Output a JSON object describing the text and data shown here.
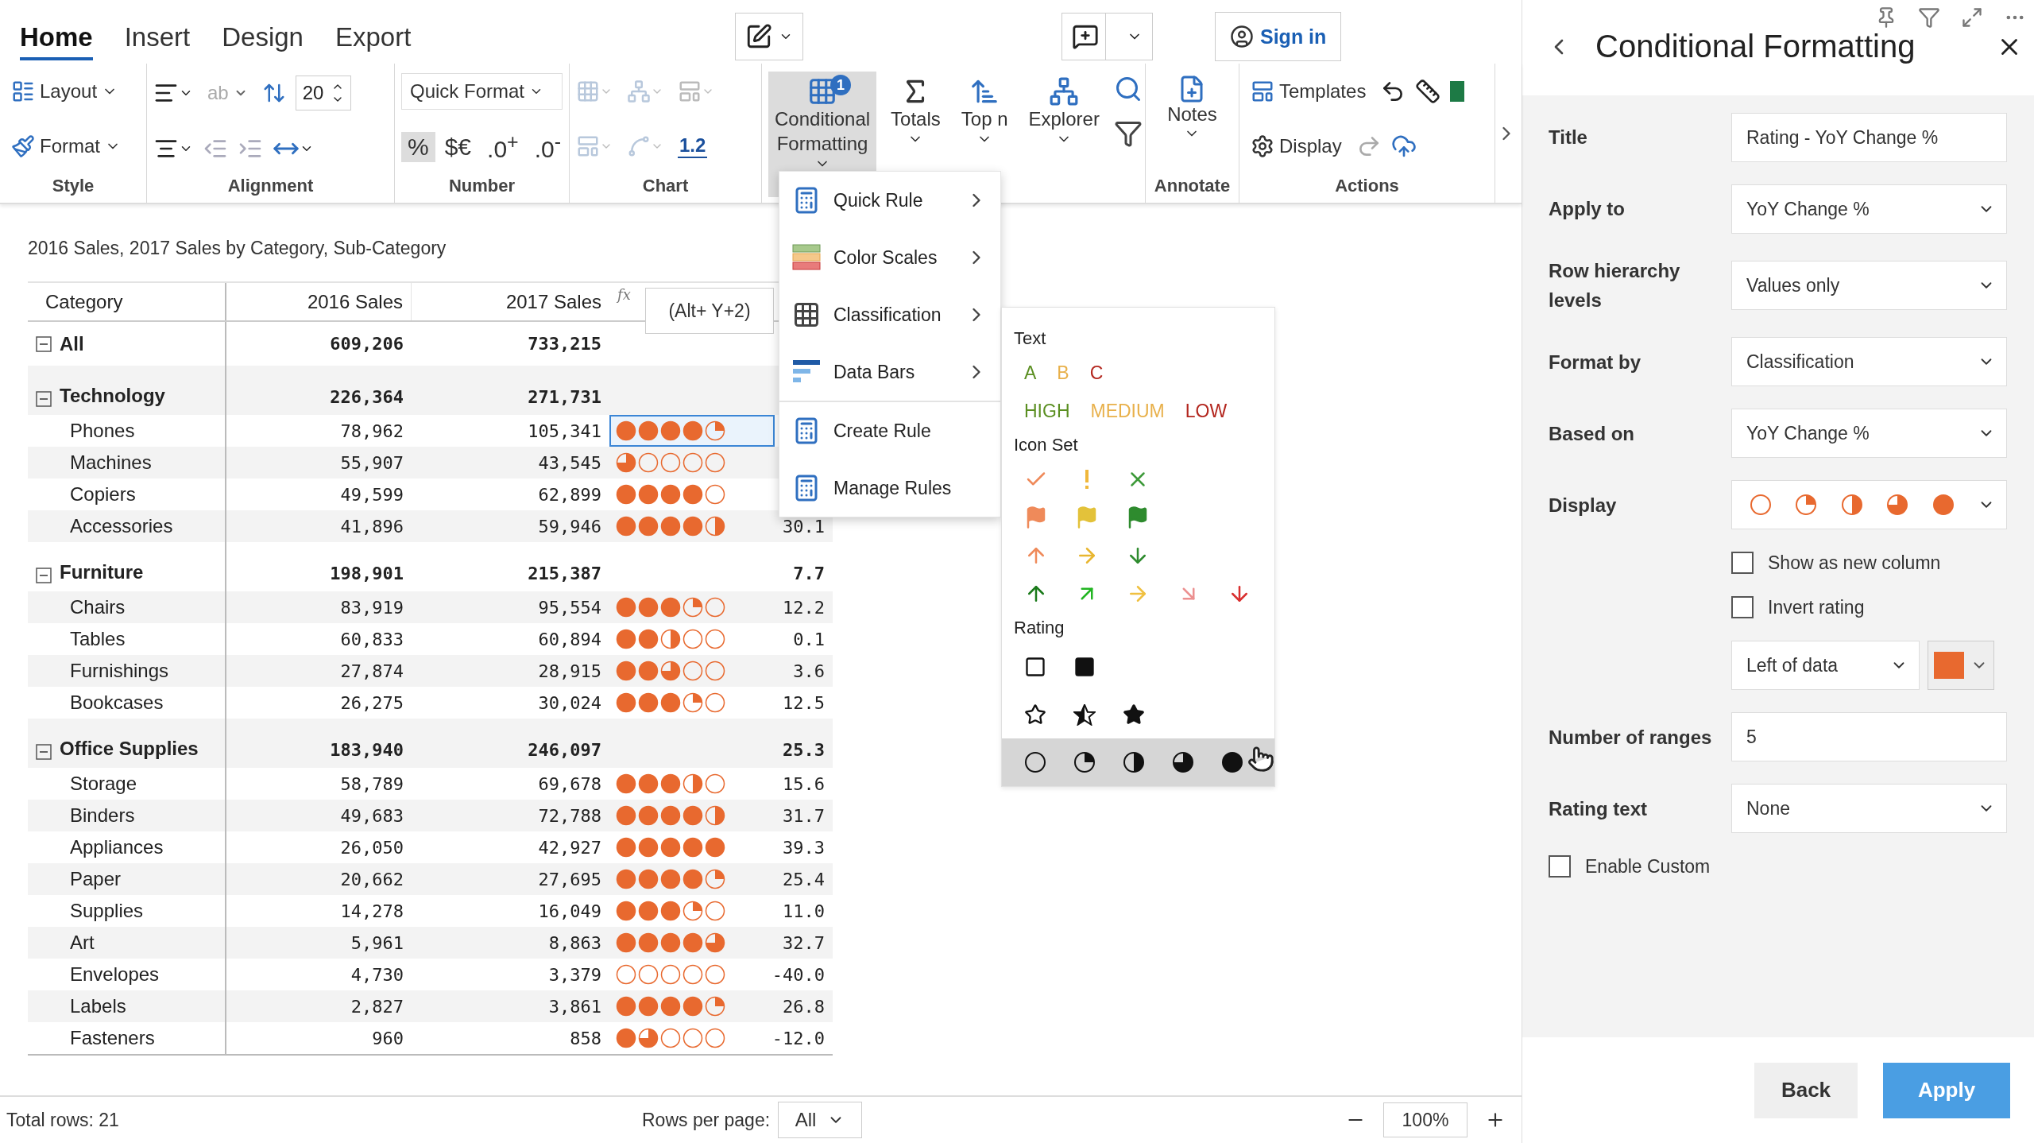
{
  "ribbon": {
    "tabs": [
      {
        "label": "Home",
        "selected": true
      },
      {
        "label": "Insert",
        "selected": false
      },
      {
        "label": "Design",
        "selected": false
      },
      {
        "label": "Export",
        "selected": false
      }
    ],
    "sign_in": "Sign in",
    "groups": [
      {
        "kind": "style",
        "label": "Style",
        "items": [
          "Layout",
          "Format"
        ]
      },
      {
        "kind": "alignment",
        "label": "Alignment",
        "wrap_label": "ab",
        "font_size": "20"
      },
      {
        "kind": "number",
        "label": "Number",
        "quick_format": "Quick Format",
        "items": [
          {
            "label": "%",
            "selected": true
          },
          {
            "label": "$€",
            "selected": false
          },
          {
            "label": ".0$^{+}$",
            "selected": false
          },
          {
            "label": ".0$^{-}$",
            "selected": false
          }
        ]
      },
      {
        "kind": "chart",
        "label": "Chart",
        "decimals": "1.2"
      },
      {
        "kind": "analysis",
        "buttons": [
          {
            "label": "Conditional Formatting",
            "badge": "1",
            "selected": true
          },
          {
            "label": "Totals",
            "selected": false
          },
          {
            "label": "Top n",
            "selected": false
          },
          {
            "label": "Explorer",
            "selected": false
          }
        ]
      },
      {
        "kind": "annotate",
        "label": "Annotate",
        "notes": "Notes"
      },
      {
        "kind": "actions",
        "label": "Actions",
        "items": [
          "Templates",
          "Display"
        ]
      }
    ]
  },
  "table": {
    "title": "2016 Sales, 2017 Sales by Category, Sub-Category",
    "columns": [
      "Category",
      "2016 Sales",
      "2017 Sales"
    ],
    "formula_mark": "fx",
    "tooltip": "(Alt+ Y+2)",
    "rows": [
      {
        "label": "All",
        "expanded": true,
        "sales_2016": "609,206",
        "sales_2017": "733,215"
      },
      {
        "label": "Technology",
        "expanded": true,
        "sales_2016": "226,364",
        "sales_2017": "271,731",
        "children": [
          {
            "label": "Phones",
            "sales_2016": "78,962",
            "sales_2017": "105,341",
            "stars": 4.25,
            "selected": true
          },
          {
            "label": "Machines",
            "sales_2016": "55,907",
            "sales_2017": "43,545",
            "stars": 0.75,
            "selected": false
          },
          {
            "label": "Copiers",
            "sales_2016": "49,599",
            "sales_2017": "62,899",
            "stars": 4,
            "selected": false
          },
          {
            "label": "Accessories",
            "sales_2016": "41,896",
            "sales_2017": "59,946",
            "stars": 4.5,
            "change": "30.1",
            "selected": false
          }
        ]
      },
      {
        "label": "Furniture",
        "expanded": true,
        "sales_2016": "198,901",
        "sales_2017": "215,387",
        "change": "7.7",
        "children": [
          {
            "label": "Chairs",
            "sales_2016": "83,919",
            "sales_2017": "95,554",
            "stars": 3.25,
            "change": "12.2",
            "selected": false
          },
          {
            "label": "Tables",
            "sales_2016": "60,833",
            "sales_2017": "60,894",
            "stars": 2.5,
            "change": "0.1",
            "selected": false
          },
          {
            "label": "Furnishings",
            "sales_2016": "27,874",
            "sales_2017": "28,915",
            "stars": 2.75,
            "change": "3.6",
            "selected": false
          },
          {
            "label": "Bookcases",
            "sales_2016": "26,275",
            "sales_2017": "30,024",
            "stars": 3.25,
            "change": "12.5",
            "selected": false
          }
        ]
      },
      {
        "label": "Office Supplies",
        "expanded": true,
        "sales_2016": "183,940",
        "sales_2017": "246,097",
        "change": "25.3",
        "children": [
          {
            "label": "Storage",
            "sales_2016": "58,789",
            "sales_2017": "69,678",
            "stars": 3.5,
            "change": "15.6",
            "selected": false
          },
          {
            "label": "Binders",
            "sales_2016": "49,683",
            "sales_2017": "72,788",
            "stars": 4.5,
            "change": "31.7",
            "selected": false
          },
          {
            "label": "Appliances",
            "sales_2016": "26,050",
            "sales_2017": "42,927",
            "stars": 5,
            "change": "39.3",
            "selected": false
          },
          {
            "label": "Paper",
            "sales_2016": "20,662",
            "sales_2017": "27,695",
            "stars": 4.25,
            "change": "25.4",
            "selected": false
          },
          {
            "label": "Supplies",
            "sales_2016": "14,278",
            "sales_2017": "16,049",
            "stars": 3.25,
            "change": "11.0",
            "selected": false
          },
          {
            "label": "Art",
            "sales_2016": "5,961",
            "sales_2017": "8,863",
            "stars": 4.75,
            "change": "32.7",
            "selected": false
          },
          {
            "label": "Envelopes",
            "sales_2016": "4,730",
            "sales_2017": "3,379",
            "stars": 0,
            "change": "-40.0",
            "selected": false
          },
          {
            "label": "Labels",
            "sales_2016": "2,827",
            "sales_2017": "3,861",
            "stars": 4.25,
            "change": "26.8",
            "selected": false
          },
          {
            "label": "Fasteners",
            "sales_2016": "960",
            "sales_2017": "858",
            "stars": 1.75,
            "change": "-12.0",
            "selected": false
          }
        ]
      }
    ]
  },
  "menu": {
    "sections": [
      [
        {
          "kind": "quick-rule",
          "label": "Quick Rule",
          "submenu": true
        },
        {
          "kind": "color-scales",
          "label": "Color Scales",
          "submenu": true
        },
        {
          "kind": "classification",
          "label": "Classification",
          "submenu": true
        },
        {
          "kind": "data-bars",
          "label": "Data Bars",
          "submenu": true
        }
      ],
      [
        {
          "kind": "create-rule",
          "label": "Create Rule",
          "submenu": false
        },
        {
          "kind": "manage-rules",
          "label": "Manage Rules",
          "submenu": false
        }
      ]
    ]
  },
  "submenu": {
    "text_header": "Text",
    "letters": [
      {
        "label": "A",
        "color": "#5b8f22"
      },
      {
        "label": "B",
        "color": "#e8b04a"
      },
      {
        "label": "C",
        "color": "#b3261e"
      }
    ],
    "levels": [
      {
        "label": "HIGH",
        "color": "#5b8f22"
      },
      {
        "label": "MEDIUM",
        "color": "#e8b04a"
      },
      {
        "label": "LOW",
        "color": "#b3261e"
      }
    ],
    "icon_set_header": "Icon Set",
    "rating_header": "Rating",
    "rating_sets": [
      {
        "kind": "squares",
        "selected": false
      },
      {
        "kind": "stars",
        "selected": false
      },
      {
        "kind": "circles",
        "selected": true
      }
    ]
  },
  "panel": {
    "title": "Conditional Formatting",
    "fields": [
      {
        "kind": "input",
        "label": "Title",
        "value": "Rating - YoY Change %"
      },
      {
        "kind": "select",
        "label": "Apply to",
        "value": "YoY Change %"
      },
      {
        "kind": "select",
        "label": "Row hierarchy levels",
        "value": "Values only"
      },
      {
        "kind": "select",
        "label": "Format by",
        "value": "Classification"
      },
      {
        "kind": "select",
        "label": "Based on",
        "value": "YoY Change %"
      },
      {
        "kind": "display",
        "label": "Display"
      },
      {
        "kind": "checkbox",
        "label": "Show as new column",
        "checked": false
      },
      {
        "kind": "checkbox",
        "label": "Invert rating",
        "checked": false
      },
      {
        "kind": "position",
        "value": "Left of data",
        "color": "#e8692f"
      },
      {
        "kind": "input",
        "label": "Number of ranges",
        "value": "5"
      },
      {
        "kind": "select",
        "label": "Rating text",
        "value": "None"
      },
      {
        "kind": "option",
        "label": "Enable Custom",
        "checked": false
      }
    ],
    "buttons": [
      {
        "label": "Back",
        "kind": "secondary"
      },
      {
        "label": "Apply",
        "kind": "primary"
      }
    ]
  },
  "status_bar": {
    "total": "Total rows: 21",
    "rows_per_page_label": "Rows per page:",
    "rows_per_page": "All",
    "zoom": "100%"
  }
}
